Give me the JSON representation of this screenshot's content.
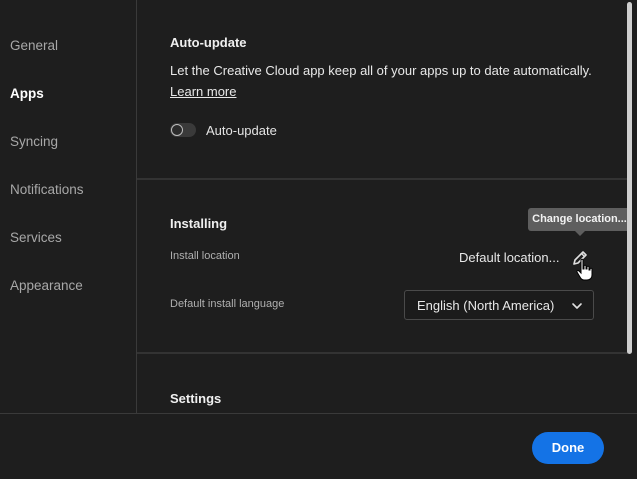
{
  "sidebar": {
    "items": [
      {
        "label": "General",
        "active": false
      },
      {
        "label": "Apps",
        "active": true
      },
      {
        "label": "Syncing",
        "active": false
      },
      {
        "label": "Notifications",
        "active": false
      },
      {
        "label": "Services",
        "active": false
      },
      {
        "label": "Appearance",
        "active": false
      }
    ]
  },
  "auto_update": {
    "title": "Auto-update",
    "description": "Let the Creative Cloud app keep all of your apps up to date automatically.",
    "learn_more": "Learn more",
    "toggle_label": "Auto-update",
    "toggle_on": false
  },
  "installing": {
    "title": "Installing",
    "install_location_label": "Install location",
    "install_location_value": "Default location...",
    "edit_icon": "pencil-icon",
    "tooltip": "Change location...",
    "language_label": "Default install language",
    "language_value": "English (North America)",
    "chevron_icon": "chevron-down-icon"
  },
  "settings": {
    "title": "Settings"
  },
  "footer": {
    "done_label": "Done"
  },
  "colors": {
    "background": "#1e1e1e",
    "accent": "#1473e6",
    "tooltip": "#5e5e5e"
  }
}
